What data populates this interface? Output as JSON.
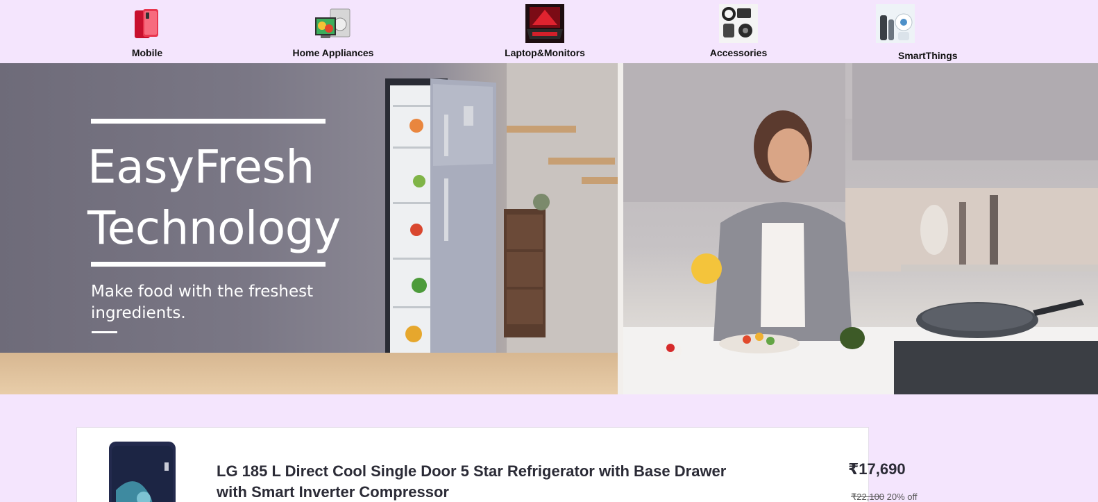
{
  "categories": [
    {
      "label": "Mobile",
      "icon": "mobile-phone-icon"
    },
    {
      "label": "Home Appliances",
      "icon": "washing-machine-icon"
    },
    {
      "label": "Laptop&Monitors",
      "icon": "laptop-icon"
    },
    {
      "label": "Accessories",
      "icon": "accessories-icon"
    },
    {
      "label": "SmartThings",
      "icon": "smart-devices-icon"
    }
  ],
  "banner": {
    "headline_line1": "EasyFresh",
    "headline_line2": "Technology",
    "subline_line1": "Make food with the freshest",
    "subline_line2": "ingredients."
  },
  "product": {
    "title": "LG 185 L Direct Cool Single Door 5 Star Refrigerator with Base Drawer with Smart Inverter Compressor",
    "price": "₹17,690",
    "old_price": "₹22,100",
    "discount": "20% off"
  },
  "colors": {
    "page_background": "#f4e5fd",
    "card_background": "#ffffff",
    "text_dark": "#2b2b36"
  }
}
